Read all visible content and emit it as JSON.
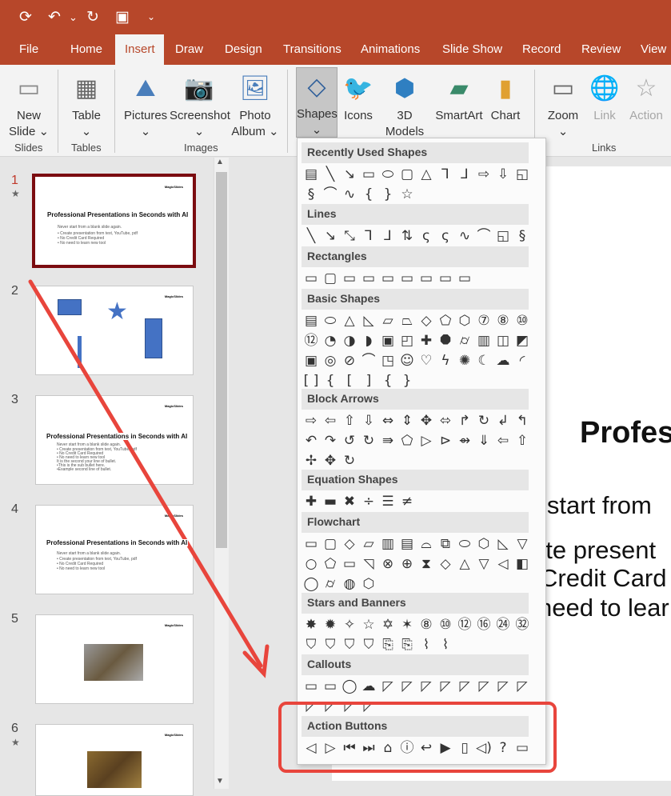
{
  "quick_access": {
    "autosave": "⟳",
    "undo": "↶",
    "undo_more": "⌄",
    "redo": "↻",
    "present": "▣",
    "customize": "⌄"
  },
  "tabs": [
    "File",
    "Home",
    "Insert",
    "Draw",
    "Design",
    "Transitions",
    "Animations",
    "Slide Show",
    "Record",
    "Review",
    "View"
  ],
  "ribbon": {
    "new_slide": "New",
    "new_slide2": "Slide ⌄",
    "table": "Table",
    "pictures": "Pictures",
    "screenshot": "Screenshot",
    "photo_album": "Photo",
    "photo_album2": "Album ⌄",
    "shapes": "Shapes",
    "icons": "Icons",
    "models": "3D",
    "models2": "Models ⌄",
    "smartart": "SmartArt",
    "chart": "Chart",
    "zoom": "Zoom",
    "link": "Link",
    "action": "Action",
    "chev": "⌄",
    "groups": {
      "slides": "Slides",
      "tables": "Tables",
      "images": "Images",
      "links": "Links"
    }
  },
  "slides": [
    {
      "num": "1",
      "star": "★",
      "title": "Professional Presentations in Seconds with AI",
      "lines": [
        "Never start from a blank slide again.",
        "• Create presentation from text, YouTube, pdf",
        "• No Credit Card Required",
        "• No need to learn new tool"
      ]
    },
    {
      "num": "2"
    },
    {
      "num": "3",
      "title": "Professional Presentations in Seconds with AI",
      "lines": [
        "Never start from a blank slide again.",
        "• Create presentation from text, YouTube, pdf",
        "• No Credit Card Required",
        "• No need to learn new tool",
        "It is the second your line of bullet.",
        "  •This is the sub bullet here.",
        "  •Example second line of bullet."
      ]
    },
    {
      "num": "4",
      "title": "Professional Presentations in Seconds with AI",
      "lines": [
        "Never start from a blank slide again.",
        "• Create presentation from text, YouTube, pdf",
        "• No Credit Card Required",
        "• No need to learn new tool"
      ]
    },
    {
      "num": "5"
    },
    {
      "num": "6",
      "star": "★"
    }
  ],
  "logo": "MagicSlides",
  "main_slide": {
    "title": "Profess",
    "l1": "r start from",
    "l2": "ate present",
    "l3": "Credit Card",
    "l4": "need to lear"
  },
  "gallery": {
    "sections": [
      {
        "title": "Recently Used Shapes",
        "rows": [
          [
            "▤",
            "╲",
            "↘",
            "▭",
            "⬭",
            "▢",
            "△",
            "⅂",
            "⅃",
            "⇨",
            "⇩",
            "◱"
          ],
          [
            "§",
            "⌒",
            "∿",
            "{",
            "}",
            "☆"
          ]
        ]
      },
      {
        "title": "Lines",
        "rows": [
          [
            "╲",
            "↘",
            "⤡",
            "⅂",
            "⅃",
            "⇅",
            "ς",
            "ς",
            "∿",
            "⌒",
            "◱",
            "§"
          ]
        ]
      },
      {
        "title": "Rectangles",
        "rows": [
          [
            "▭",
            "▢",
            "▭",
            "▭",
            "▭",
            "▭",
            "▭",
            "▭",
            "▭"
          ]
        ]
      },
      {
        "title": "Basic Shapes",
        "rows": [
          [
            "▤",
            "⬭",
            "△",
            "◺",
            "▱",
            "⏢",
            "◇",
            "⬠",
            "⬡",
            "⑦",
            "⑧",
            "⑩"
          ],
          [
            "⑫",
            "◔",
            "◑",
            "◗",
            "▣",
            "◰",
            "✚",
            "⯃",
            "⌭",
            "▥",
            "◫",
            "◩"
          ],
          [
            "▣",
            "◎",
            "⊘",
            "⌒",
            "◳",
            "☺",
            "♡",
            "ϟ",
            "✺",
            "☾",
            "☁",
            "◜"
          ],
          [
            "[ ]",
            "{ }",
            "[",
            "]",
            "{",
            "}"
          ]
        ]
      },
      {
        "title": "Block Arrows",
        "rows": [
          [
            "⇨",
            "⇦",
            "⇧",
            "⇩",
            "⇔",
            "⇕",
            "✥",
            "⬄",
            "↱",
            "↻",
            "↲",
            "↰"
          ],
          [
            "↶",
            "↷",
            "↺",
            "↻",
            "⇛",
            "⬠",
            "▷",
            "⊳",
            "⇴",
            "⇓",
            "⇦",
            "⇧"
          ],
          [
            "✢",
            "✥",
            "↻"
          ]
        ]
      },
      {
        "title": "Equation Shapes",
        "rows": [
          [
            "✚",
            "▬",
            "✖",
            "÷",
            "☰",
            "≠"
          ]
        ]
      },
      {
        "title": "Flowchart",
        "rows": [
          [
            "▭",
            "▢",
            "◇",
            "▱",
            "▥",
            "▤",
            "⌓",
            "⧉",
            "⬭",
            "⬡",
            "◺",
            "▽"
          ],
          [
            "○",
            "⬠",
            "▭",
            "◹",
            "⊗",
            "⊕",
            "⧗",
            "◇",
            "△",
            "▽",
            "◁",
            "◧"
          ],
          [
            "◯",
            "⌭",
            "◍",
            "⬡"
          ]
        ]
      },
      {
        "title": "Stars and Banners",
        "rows": [
          [
            "✸",
            "✹",
            "✧",
            "☆",
            "✡",
            "✶",
            "⑧",
            "⑩",
            "⑫",
            "⑯",
            "㉔",
            "㉜"
          ],
          [
            "⛉",
            "⛉",
            "⛉",
            "⛉",
            "⎘",
            "⎘",
            "⌇",
            "⌇"
          ]
        ]
      },
      {
        "title": "Callouts",
        "rows": [
          [
            "▭",
            "▭",
            "◯",
            "☁",
            "◸",
            "◸",
            "◸",
            "◸",
            "◸",
            "◸",
            "◸",
            "◸"
          ],
          [
            "◸",
            "◸",
            "◸",
            "◸"
          ]
        ]
      },
      {
        "title": "Action Buttons",
        "rows": [
          [
            "◁",
            "▷",
            "⏮",
            "⏭",
            "⌂",
            "ⓘ",
            "↩",
            "▶",
            "▯",
            "◁)",
            "?",
            "▭"
          ]
        ]
      }
    ]
  },
  "colors": {
    "accent": "#b7472a",
    "annotation": "#e8453c",
    "selection": "#7b0c10"
  }
}
